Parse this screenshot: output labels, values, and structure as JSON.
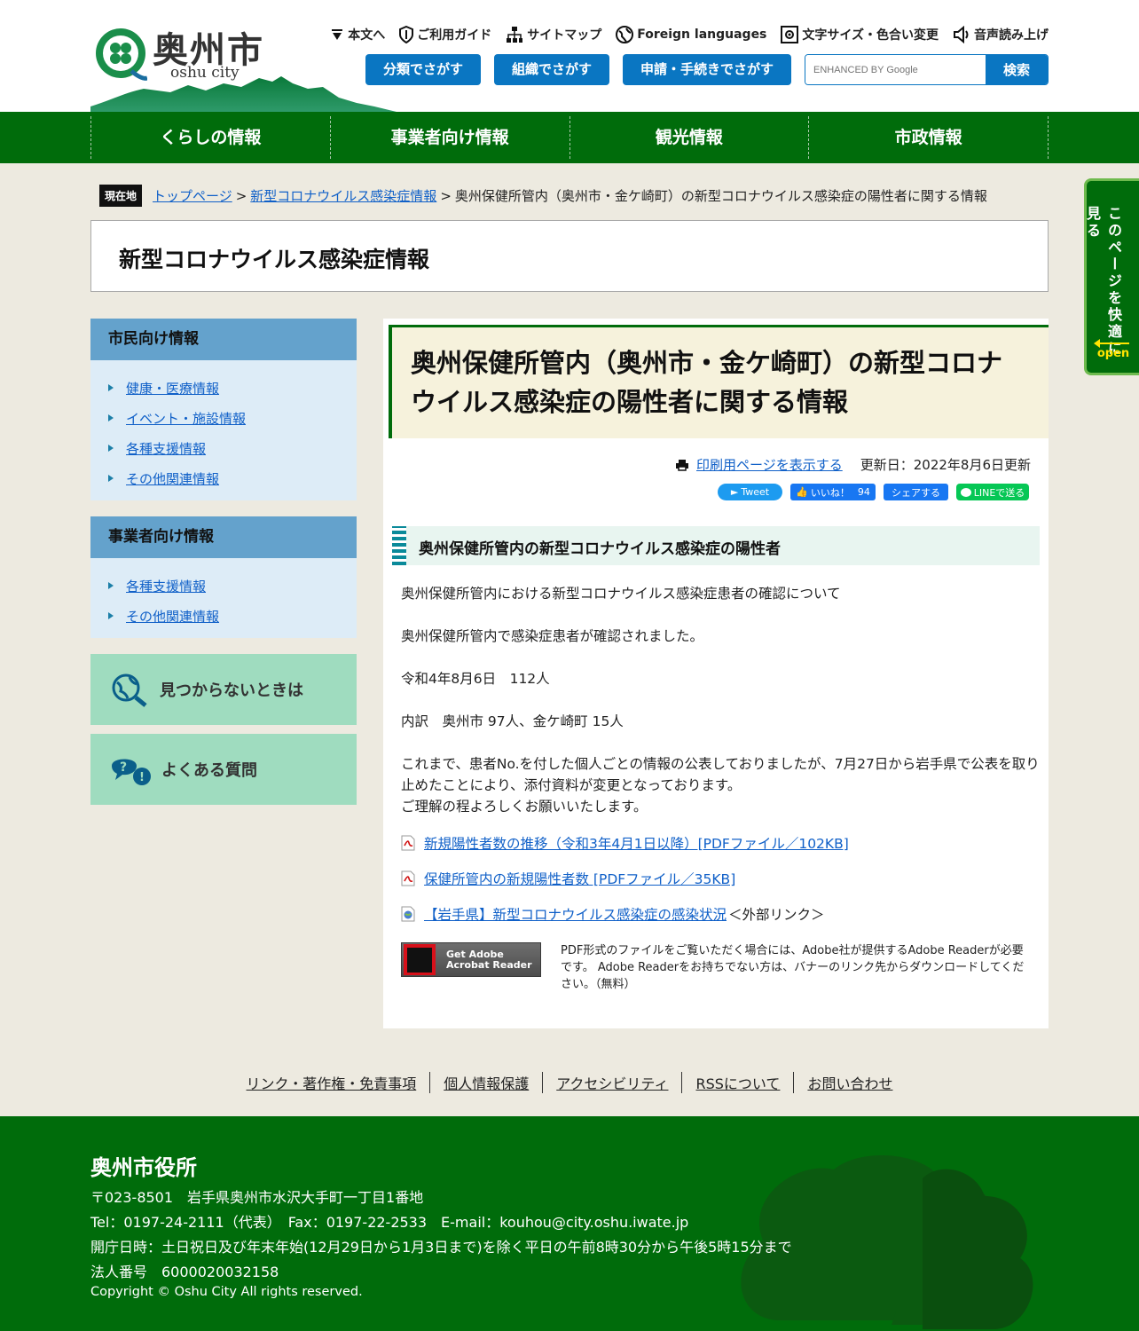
{
  "header": {
    "site_name": "奥州市",
    "site_name_sub": "oshu city",
    "utility": [
      "本文へ",
      "ご利用ガイド",
      "サイトマップ",
      "Foreign languages",
      "文字サイズ・色合い変更",
      "音声読み上げ"
    ],
    "buttons": [
      "分類でさがす",
      "組織でさがす",
      "申請・手続きでさがす"
    ],
    "search_placeholder": "ENHANCED BY Google",
    "search_button": "検索"
  },
  "nav": [
    "くらしの情報",
    "事業者向け情報",
    "観光情報",
    "市政情報"
  ],
  "side_tab": {
    "text": "このページを快適に見る",
    "open": "open"
  },
  "breadcrumb": {
    "here": "現在地",
    "items": [
      "トップページ",
      "新型コロナウイルス感染症情報"
    ],
    "current": "奥州保健所管内（奥州市・金ケ崎町）の新型コロナウイルス感染症の陽性者に関する情報",
    "sep": ">"
  },
  "category_title": "新型コロナウイルス感染症情報",
  "sidebar": {
    "citizen": {
      "title": "市民向け情報",
      "items": [
        "健康・医療情報",
        "イベント・施設情報",
        "各種支援情報",
        "その他関連情報"
      ]
    },
    "business": {
      "title": "事業者向け情報",
      "items": [
        "各種支援情報",
        "その他関連情報"
      ]
    },
    "banner_not_found": "見つからないときは",
    "banner_faq": "よくある質問"
  },
  "article": {
    "title": "奥州保健所管内（奥州市・金ケ崎町）の新型コロナウイルス感染症の陽性者に関する情報",
    "print_link": "印刷用ページを表示する",
    "updated": "更新日：2022年8月6日更新",
    "social": {
      "tweet": "Tweet",
      "like": "いいね！",
      "like_count": "94",
      "share": "シェアする",
      "line": "LINEで送る"
    },
    "section_heading": "奥州保健所管内の新型コロナウイルス感染症の陽性者",
    "paragraphs": [
      "奥州保健所管内における新型コロナウイルス感染症患者の確認について",
      "奥州保健所管内で感染症患者が確認されました。",
      "令和4年8月6日　112人",
      "内訳　奥州市 97人、金ケ崎町 15人"
    ],
    "notice_lines": [
      "これまで、患者No.を付した個人ごとの情報の公表しておりましたが、7月27日から岩手県で公表を取り止めたことにより、添付資料が変更となっております。",
      "ご理解の程よろしくお願いいたします。"
    ],
    "files": [
      {
        "label": "新規陽性者数の推移（令和3年4月1日以降）[PDFファイル／102KB]"
      },
      {
        "label": "保健所管内の新規陽性者数 [PDFファイル／35KB]"
      }
    ],
    "external": {
      "label": "【岩手県】新型コロナウイルス感染症の感染状況",
      "suffix": "＜外部リンク＞"
    },
    "adobe_banner": {
      "line1": "Get Adobe",
      "line2": "Acrobat Reader"
    },
    "adobe_note": "PDF形式のファイルをご覧いただく場合には、Adobe社が提供するAdobe Readerが必要です。 Adobe Readerをお持ちでない方は、バナーのリンク先からダウンロードしてください。（無料）"
  },
  "footer_links": [
    "リンク・著作権・免責事項",
    "個人情報保護",
    "アクセシビリティ",
    "RSSについて",
    "お問い合わせ"
  ],
  "footer": {
    "org": "奥州市役所",
    "address": "〒023-8501　岩手県奥州市水沢大手町一丁目1番地",
    "contact": "Tel：0197-24-2111（代表）　Fax：0197-22-2533　E-mail：kouhou@city.oshu.iwate.jp",
    "hours": "開庁日時：土日祝日及び年末年始(12月29日から1月3日まで)を除く平日の午前8時30分から午後5時15分まで",
    "corp_number": "法人番号　6000020032158",
    "copyright": "Copyright © Oshu City All rights reserved."
  },
  "colors": {
    "brand_green": "#006c0b",
    "accent_blue": "#0a76c2",
    "background": "#edeae0"
  }
}
